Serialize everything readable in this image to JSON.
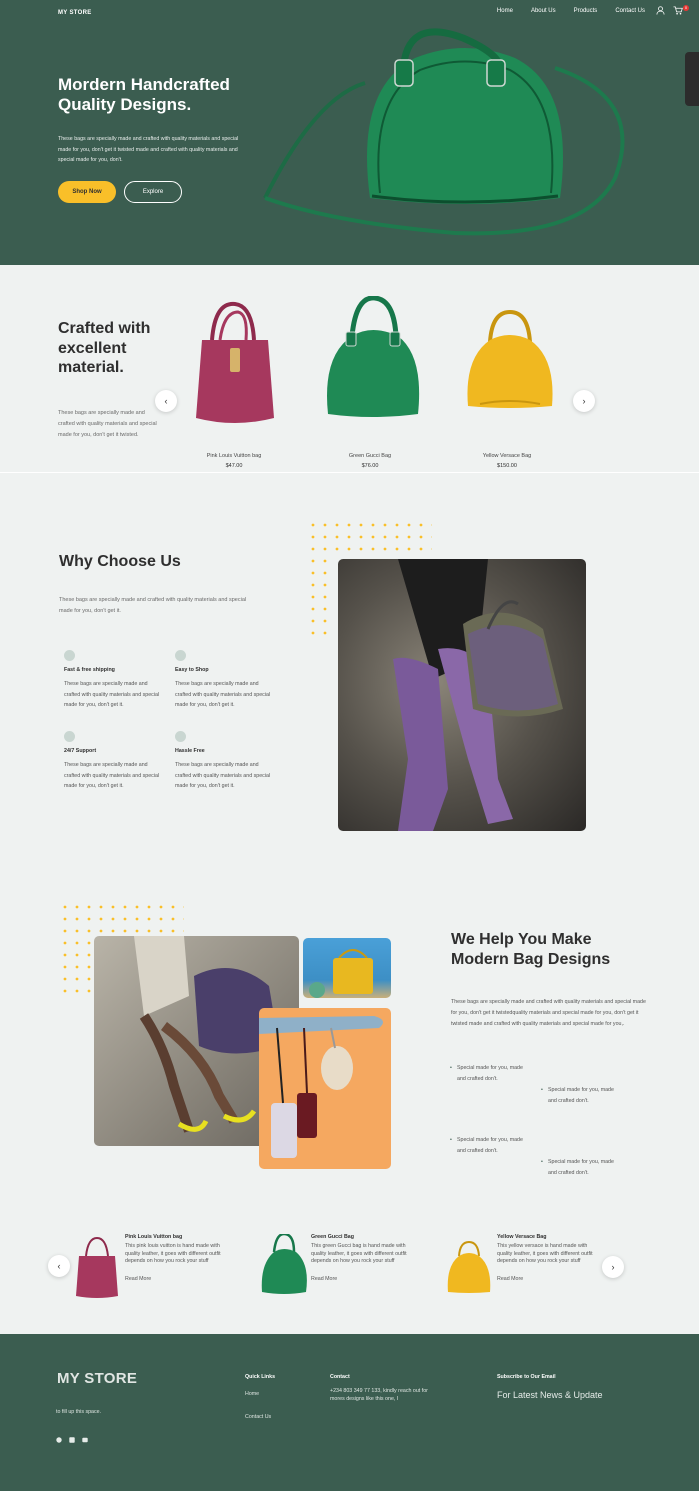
{
  "header": {
    "logo": "MY STORE",
    "nav": [
      "Home",
      "About Us",
      "Products",
      "Contact Us"
    ],
    "cart_count": "0"
  },
  "hero": {
    "title": "Mordern Handcrafted Quality Designs.",
    "description": "These bags are specially made and crafted with quality materials and special made for you, don't get it twisted made and crafted with quality materials and special made for you, don't.",
    "primary_button": "Shop Now",
    "secondary_button": "Explore"
  },
  "products_section": {
    "title": "Crafted with excellent material.",
    "description": "These bags are specially made and crafted with quality materials and special made for you, don't get it twisted.",
    "items": [
      {
        "name": "Pink Louis Vuitton bag",
        "price": "$47.00",
        "color": "#a6385e"
      },
      {
        "name": "Green Gucci Bag",
        "price": "$76.00",
        "color": "#1f8a55"
      },
      {
        "name": "Yellow Versace Bag",
        "price": "$150.00",
        "color": "#f0b820"
      }
    ]
  },
  "why": {
    "title": "Why Choose Us",
    "description": "These bags are specially made and crafted with quality materials and special made for you, don't get it.",
    "features": [
      {
        "title": "Fast & free shipping",
        "text": "These bags are specially made and crafted with quality materials and special made for you, don't get it."
      },
      {
        "title": "Easy to Shop",
        "text": "These bags are specially made and crafted with quality materials and special made for you, don't get it."
      },
      {
        "title": "24/7 Support",
        "text": "These bags are specially made and crafted with quality materials and special made for you, don't get it."
      },
      {
        "title": "Hassle Free",
        "text": "These bags are specially made and crafted with quality materials and special made for you, don't get it."
      }
    ]
  },
  "help": {
    "title": "We Help You Make Modern Bag Designs",
    "description": "These bags are specially made and crafted with quality materials and special made for you, don't get it twistedquality materials and special made for you, don't get it twisted made and crafted with quality materials and special made for you,.",
    "bullets": [
      "Special made for you, made and crafted don't.",
      "Special made for you, made and crafted don't.",
      "Special made for you, made and crafted don't.",
      "Special made for you, made and crafted don't."
    ]
  },
  "blog": {
    "read_more": "Read More",
    "items": [
      {
        "title": "Pink Louis Vuitton bag",
        "text": "This pink louis vuitton is hand made with quality leather, it goes with different outfit depends on how you rock your stuff"
      },
      {
        "title": "Green Gucci Bag",
        "text": "This green Gucci bag is hand made with quality leather, it goes with different outfit depends on how you rock your stuff"
      },
      {
        "title": "Yellow Versace Bag",
        "text": "This yellow versace is hand made with quality leather, it goes with different outfit depends on how you rock your stuff"
      }
    ]
  },
  "footer": {
    "logo": "MY STORE",
    "tagline": "to fill up this space.",
    "quick_links_title": "Quick Links",
    "links": [
      "Home",
      "Contact Us"
    ],
    "contact_title": "Contact",
    "contact_text": "+234 803 349 77 133, kindly reach out for mores designs like this one, I",
    "subscribe_title": "Subscribe to Our Email",
    "subscribe_text": "For Latest News & Update",
    "social_icons": [
      "github-icon",
      "linkedin-icon",
      "youtube-icon"
    ]
  },
  "colors": {
    "brand_green": "#3b5d50",
    "accent_yellow": "#f9bf29",
    "background": "#eff2f1"
  }
}
